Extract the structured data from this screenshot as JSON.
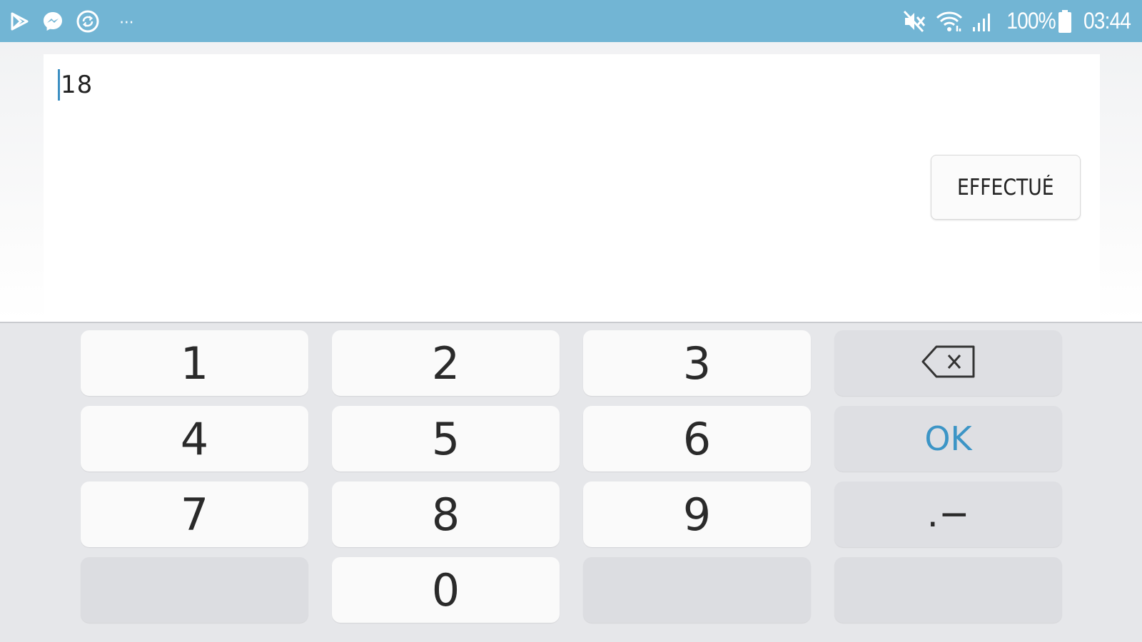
{
  "status_bar": {
    "left_icons": [
      "play-store-icon",
      "messenger-icon",
      "sync-icon",
      "more-notifications-icon"
    ],
    "more_label": "···",
    "right_icons": [
      "mute-icon",
      "wifi-icon",
      "signal-icon",
      "battery-icon"
    ],
    "battery_percent": "100%",
    "time": "03:44"
  },
  "editor": {
    "value": "18",
    "done_label": "EFFECTUÉ"
  },
  "keyboard": {
    "keys": [
      "1",
      "2",
      "3",
      "4",
      "5",
      "6",
      "7",
      "8",
      "9",
      "0"
    ],
    "backspace_icon": "backspace-icon",
    "ok_label": "OK",
    "symbol_label": ".−"
  },
  "colors": {
    "status_bar": "#72b5d4",
    "accent": "#3c95c6",
    "caret": "#3c8fc2",
    "keyboard_bg": "#e6e7ea",
    "key_light": "#fafafa",
    "key_dark": "#dedfe3"
  }
}
